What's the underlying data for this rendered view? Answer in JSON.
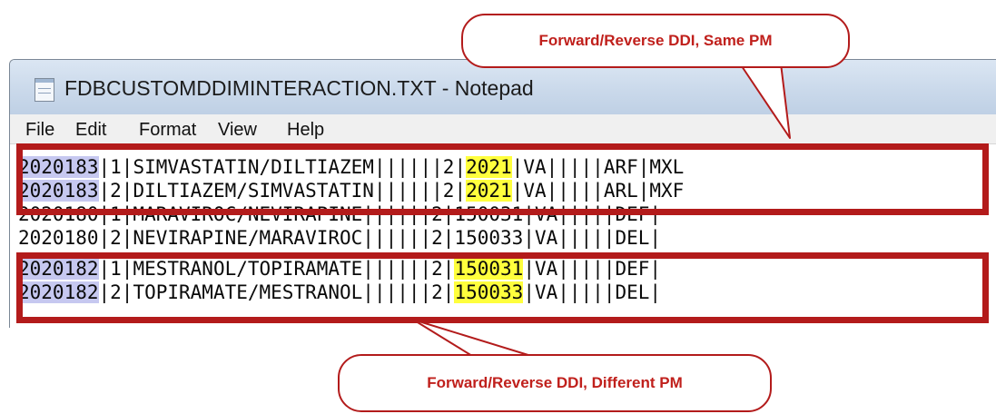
{
  "window": {
    "title": "FDBCUSTOMDDIMINTERACTION.TXT - Notepad",
    "icon": "notepad-icon"
  },
  "menu": [
    "File",
    "Edit",
    "Format",
    "View",
    "Help"
  ],
  "lines": [
    {
      "sel": "2020183",
      "a": "|1|SIMVASTATIN/DILTIAZEM||||||2|",
      "hl": "2021",
      "b": "|VA|||||ARF|MXL"
    },
    {
      "sel": "2020183",
      "a": "|2|DILTIAZEM/SIMVASTATIN||||||2|",
      "hl": "2021",
      "b": "|VA|||||ARL|MXF"
    },
    {
      "sel": "",
      "a": "2020180|1|MARAVIROC/NEVIRAPINE||||||2|150031|VA|||||DEF|",
      "hl": "",
      "b": ""
    },
    {
      "sel": "",
      "a": "2020180|2|NEVIRAPINE/MARAVIROC||||||2|150033|VA|||||DEL|",
      "hl": "",
      "b": ""
    },
    {
      "sel": "2020182",
      "a": "|1|MESTRANOL/TOPIRAMATE||||||2|",
      "hl": "150031",
      "b": "|VA|||||DEF|"
    },
    {
      "sel": "2020182",
      "a": "|2|TOPIRAMATE/MESTRANOL||||||2|",
      "hl": "150033",
      "b": "|VA|||||DEL|"
    }
  ],
  "callouts": {
    "top": "Forward/Reverse DDI, Same PM",
    "bottom": "Forward/Reverse DDI, Different PM"
  },
  "colors": {
    "annotation_red": "#b31b1b",
    "highlight_yellow": "#ffff3d",
    "selection_blue": "#c6c8f0"
  }
}
